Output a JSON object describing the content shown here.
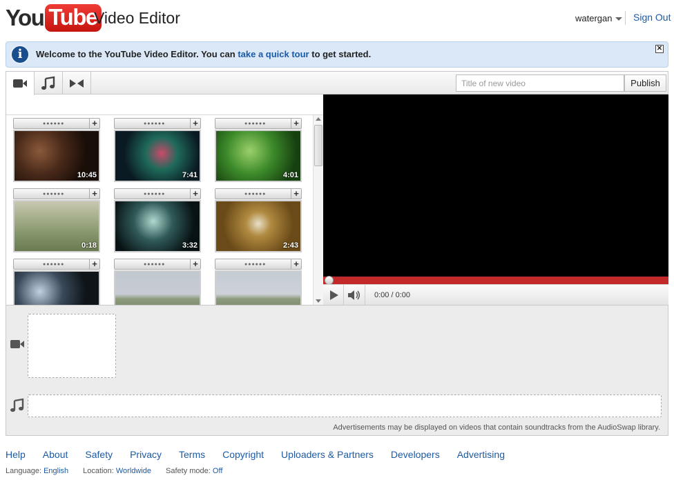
{
  "header": {
    "logo_you": "You",
    "logo_tube": "Tube",
    "title": "Video Editor",
    "username": "watergan",
    "sign_out": "Sign Out"
  },
  "banner": {
    "text_before": "Welcome to the YouTube Video Editor. You can ",
    "link": "take a quick tour",
    "text_after": " to get started.",
    "close": "✕"
  },
  "toolbar": {
    "tabs": [
      {
        "name": "video-camera-icon",
        "active": true
      },
      {
        "name": "music-note-icon",
        "active": false
      },
      {
        "name": "transition-icon",
        "active": false
      }
    ],
    "title_placeholder": "Title of new video",
    "title_value": "",
    "publish_label": "Publish"
  },
  "library": {
    "clips": [
      {
        "duration": "10:45"
      },
      {
        "duration": "7:41"
      },
      {
        "duration": "4:01"
      },
      {
        "duration": "0:18"
      },
      {
        "duration": "3:32"
      },
      {
        "duration": "2:43"
      },
      {
        "duration": ""
      },
      {
        "duration": ""
      },
      {
        "duration": ""
      }
    ],
    "add_label": "+"
  },
  "player": {
    "time": "0:00 / 0:00",
    "progress": 0
  },
  "timeline": {
    "ad_note": "Advertisements may be displayed on videos that contain soundtracks from the AudioSwap library."
  },
  "footer": {
    "links": [
      "Help",
      "About",
      "Safety",
      "Privacy",
      "Terms",
      "Copyright",
      "Uploaders & Partners",
      "Developers",
      "Advertising"
    ],
    "language_label": "Language:",
    "language_value": "English",
    "location_label": "Location:",
    "location_value": "Worldwide",
    "safety_label": "Safety mode:",
    "safety_value": "Off"
  },
  "colors": {
    "link": "#1b5aa6",
    "banner_bg": "#dbe8f7",
    "progress": "#c22a2a",
    "youtube_red": "#e02a20"
  }
}
